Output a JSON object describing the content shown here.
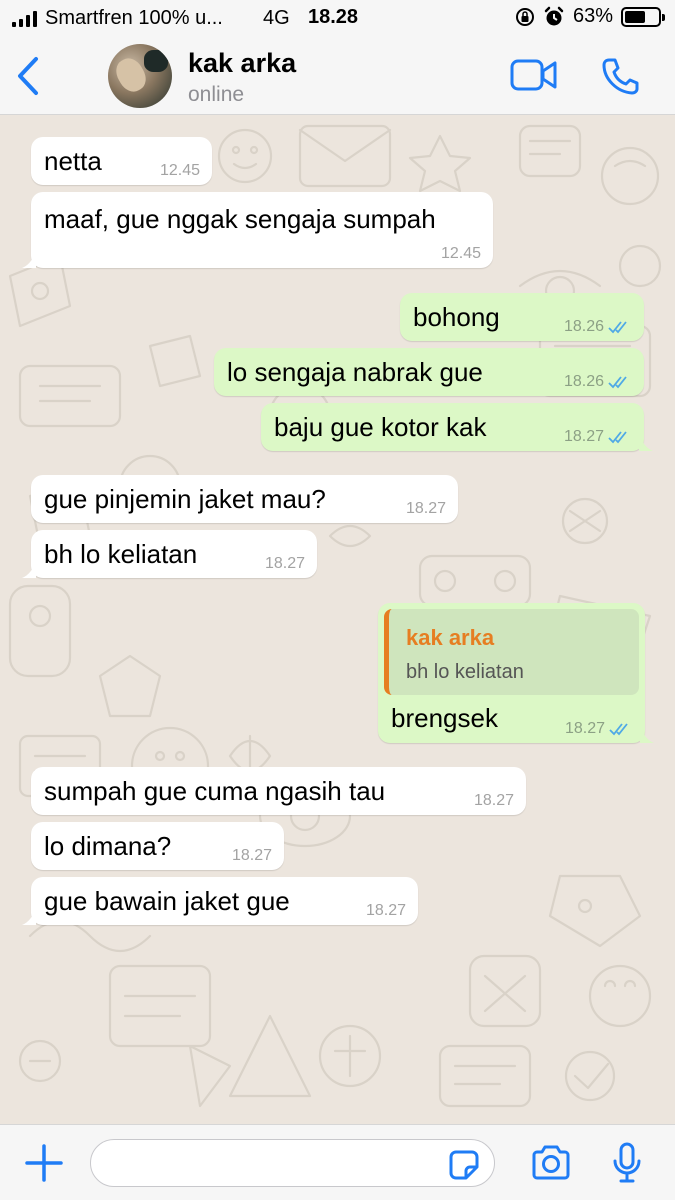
{
  "status_bar": {
    "carrier": "Smartfren 100% u...",
    "network": "4G",
    "time": "18.28",
    "battery": "63%",
    "battery_level": 0.63
  },
  "header": {
    "contact_name": "kak arka",
    "contact_status": "online",
    "icons": [
      "back-chevron-icon",
      "video-call-icon",
      "phone-call-icon"
    ]
  },
  "messages": [
    {
      "dir": "in",
      "text": "netta",
      "time": "12.45"
    },
    {
      "dir": "in",
      "text": "maaf, gue nggak sengaja sumpah",
      "time": "12.45"
    },
    {
      "dir": "out",
      "text": "bohong",
      "time": "18.26"
    },
    {
      "dir": "out",
      "text": "lo sengaja nabrak gue",
      "time": "18.26"
    },
    {
      "dir": "out",
      "text": "baju gue kotor kak",
      "time": "18.27"
    },
    {
      "dir": "in",
      "text": "gue pinjemin jaket mau?",
      "time": "18.27"
    },
    {
      "dir": "in",
      "text": "bh lo keliatan",
      "time": "18.27"
    },
    {
      "dir": "out",
      "text": "brengsek",
      "time": "18.27",
      "quote": {
        "name": "kak arka",
        "text": "bh lo keliatan"
      }
    },
    {
      "dir": "in",
      "text": "sumpah gue cuma ngasih tau",
      "time": "18.27"
    },
    {
      "dir": "in",
      "text": "lo dimana?",
      "time": "18.27"
    },
    {
      "dir": "in",
      "text": "gue bawain jaket gue",
      "time": "18.27"
    }
  ],
  "input": {
    "placeholder": "",
    "icons": [
      "plus-icon",
      "sticker-icon",
      "camera-icon",
      "microphone-icon"
    ]
  },
  "colors": {
    "accent": "#1f7cf5",
    "outgoing_bubble": "#dcf8c6",
    "incoming_bubble": "#ffffff",
    "read_tick": "#4fa9e6",
    "quote_name": "#e67e22"
  }
}
